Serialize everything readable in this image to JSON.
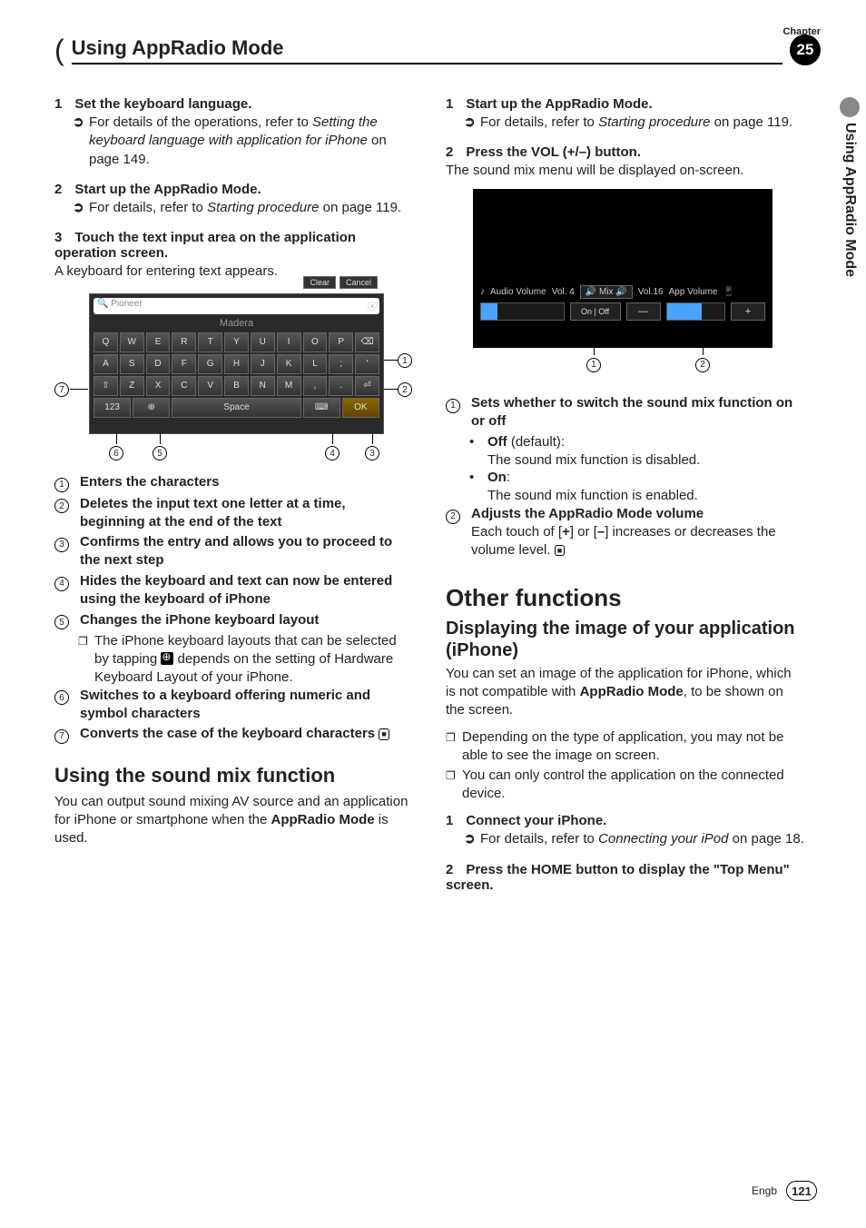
{
  "header": {
    "chapter_label": "Chapter",
    "title": "Using AppRadio Mode",
    "chapter_num": "25"
  },
  "side_tab": "Using AppRadio Mode",
  "left": {
    "step1": {
      "num": "1",
      "title": "Set the keyboard language.",
      "note_prefix": "For details of the operations, refer to ",
      "note_ref": "Setting the keyboard language with application for iPhone",
      "note_suffix": " on page 149."
    },
    "step2": {
      "num": "2",
      "title": "Start up the AppRadio Mode.",
      "note_prefix": "For details, refer to ",
      "note_ref": "Starting procedure",
      "note_suffix": " on page 119."
    },
    "step3": {
      "num": "3",
      "title": "Touch the text input area on the application operation screen.",
      "body": "A keyboard for entering text appears."
    },
    "keyboard": {
      "top_buttons": [
        "Clear",
        "Cancel"
      ],
      "search_text": "Pioneer",
      "suggest": "Madera",
      "row1": [
        "Q",
        "W",
        "E",
        "R",
        "T",
        "Y",
        "U",
        "I",
        "O",
        "P",
        "⌫"
      ],
      "row2": [
        "A",
        "S",
        "D",
        "F",
        "G",
        "H",
        "J",
        "K",
        "L",
        ";",
        "'"
      ],
      "row3": [
        "⇧",
        "Z",
        "X",
        "C",
        "V",
        "B",
        "N",
        "M",
        ",",
        ".",
        "⏎"
      ],
      "row4": [
        "123",
        "⊕",
        "Space",
        "⌨",
        "OK"
      ]
    },
    "legend": {
      "1": "Enters the characters",
      "2": "Deletes the input text one letter at a time, beginning at the end of the text",
      "3": "Confirms the entry and allows you to proceed to the next step",
      "4": "Hides the keyboard and text can now be entered using the keyboard of iPhone",
      "5": "Changes the iPhone keyboard layout",
      "5_note": "The iPhone keyboard layouts that can be selected by tapping  depends on the setting of Hardware Keyboard Layout of your iPhone.",
      "6": "Switches to a keyboard offering numeric and symbol characters",
      "7": "Converts the case of the keyboard characters"
    },
    "section2": {
      "heading": "Using the sound mix function",
      "body": "You can output sound mixing AV source and an application for iPhone or smartphone when the ",
      "bold": "AppRadio Mode",
      "body2": " is used."
    }
  },
  "right": {
    "step1": {
      "num": "1",
      "title": "Start up the AppRadio Mode.",
      "note_prefix": "For details, refer to ",
      "note_ref": "Starting procedure",
      "note_suffix": " on page 119."
    },
    "step2": {
      "num": "2",
      "title": "Press the VOL (+/–) button.",
      "body": "The sound mix menu will be displayed on-screen."
    },
    "mix_img": {
      "audio_label": "Audio Volume",
      "audio_vol": "Vol. 4",
      "mix_label": "Mix",
      "app_vol": "Vol.16",
      "app_label": "App Volume",
      "on": "On",
      "off": "Off",
      "minus": "—",
      "plus": "+"
    },
    "legend": {
      "1": {
        "title": "Sets whether to switch the sound mix function on or off",
        "off_label": "Off",
        "off_note": " (default):",
        "off_body": "The sound mix function is disabled.",
        "on_label": "On",
        "on_note": ":",
        "on_body": "The sound mix function is enabled."
      },
      "2": {
        "title": "Adjusts the AppRadio Mode volume",
        "body": "Each touch of [+] or [–] increases or decreases the volume level."
      }
    },
    "section2": {
      "heading": "Other functions",
      "subheading": "Displaying the image of your application (iPhone)",
      "body1": "You can set an image of the application for iPhone, which is not compatible with ",
      "bold": "AppRadio Mode",
      "body2": ", to be shown on the screen.",
      "note1": "Depending on the type of application, you may not be able to see the image on screen.",
      "note2": "You can only control the application on the connected device."
    },
    "step_c1": {
      "num": "1",
      "title": "Connect your iPhone.",
      "note_prefix": "For details, refer to ",
      "note_ref": "Connecting your iPod",
      "note_suffix": " on page 18."
    },
    "step_c2": {
      "num": "2",
      "title": "Press the HOME button to display the \"Top Menu\" screen."
    }
  },
  "footer": {
    "lang": "Engb",
    "page": "121"
  }
}
